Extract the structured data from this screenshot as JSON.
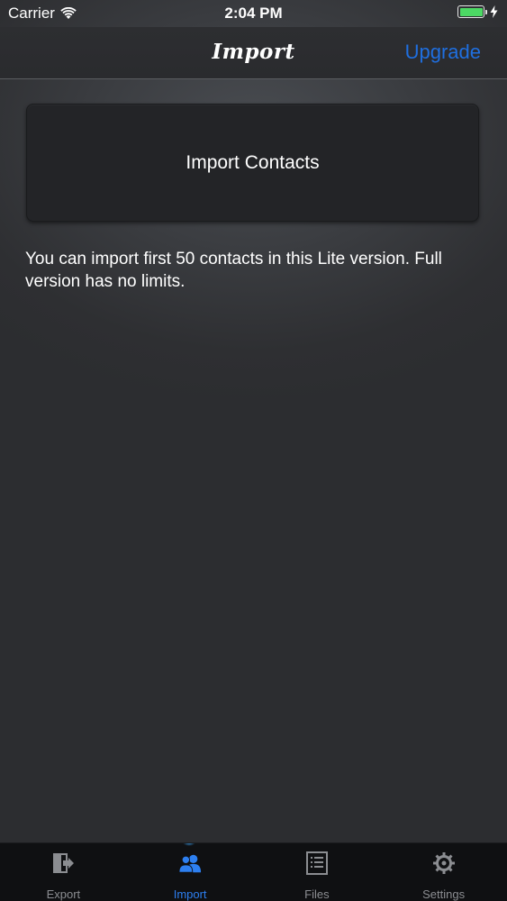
{
  "status_bar": {
    "carrier": "Carrier",
    "time": "2:04 PM",
    "battery_level": 1.0,
    "battery_color": "#4cd964"
  },
  "nav": {
    "title": "Import",
    "upgrade_label": "Upgrade",
    "upgrade_color": "#1f6fe0"
  },
  "main": {
    "import_button_label": "Import Contacts",
    "info_text": "You can import first 50 contacts in this Lite version. Full version has no limits."
  },
  "tabs": [
    {
      "label": "Export",
      "icon": "export-icon",
      "active": false
    },
    {
      "label": "Import",
      "icon": "contacts-icon",
      "active": true
    },
    {
      "label": "Files",
      "icon": "list-icon",
      "active": false
    },
    {
      "label": "Settings",
      "icon": "gear-icon",
      "active": false
    }
  ],
  "colors": {
    "accent": "#2d7ff0",
    "tab_inactive": "#8b8d91",
    "background": "#2d2e31"
  }
}
